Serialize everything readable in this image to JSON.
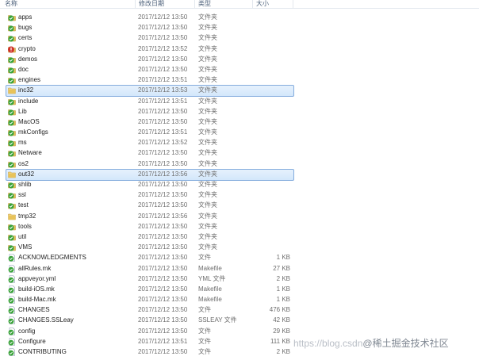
{
  "columns": {
    "name": "名称",
    "date": "修改日期",
    "type": "类型",
    "size": "大小"
  },
  "rows": [
    {
      "name": "apps",
      "date": "2017/12/12 13:50",
      "type": "文件夹",
      "size": "",
      "icon": "tortoise-folder-icon",
      "selected": false
    },
    {
      "name": "bugs",
      "date": "2017/12/12 13:50",
      "type": "文件夹",
      "size": "",
      "icon": "tortoise-folder-icon",
      "selected": false
    },
    {
      "name": "certs",
      "date": "2017/12/12 13:50",
      "type": "文件夹",
      "size": "",
      "icon": "tortoise-folder-icon",
      "selected": false
    },
    {
      "name": "crypto",
      "date": "2017/12/12 13:52",
      "type": "文件夹",
      "size": "",
      "icon": "tortoise-modified-folder-icon",
      "selected": false
    },
    {
      "name": "demos",
      "date": "2017/12/12 13:50",
      "type": "文件夹",
      "size": "",
      "icon": "tortoise-folder-icon",
      "selected": false
    },
    {
      "name": "doc",
      "date": "2017/12/12 13:50",
      "type": "文件夹",
      "size": "",
      "icon": "tortoise-folder-icon",
      "selected": false
    },
    {
      "name": "engines",
      "date": "2017/12/12 13:51",
      "type": "文件夹",
      "size": "",
      "icon": "tortoise-folder-icon",
      "selected": false
    },
    {
      "name": "inc32",
      "date": "2017/12/12 13:53",
      "type": "文件夹",
      "size": "",
      "icon": "folder-icon",
      "selected": true
    },
    {
      "name": "include",
      "date": "2017/12/12 13:51",
      "type": "文件夹",
      "size": "",
      "icon": "tortoise-folder-icon",
      "selected": false
    },
    {
      "name": "Lib",
      "date": "2017/12/12 13:50",
      "type": "文件夹",
      "size": "",
      "icon": "tortoise-folder-icon",
      "selected": false
    },
    {
      "name": "MacOS",
      "date": "2017/12/12 13:50",
      "type": "文件夹",
      "size": "",
      "icon": "tortoise-folder-icon",
      "selected": false
    },
    {
      "name": "mkConfigs",
      "date": "2017/12/12 13:51",
      "type": "文件夹",
      "size": "",
      "icon": "tortoise-folder-icon",
      "selected": false
    },
    {
      "name": "ms",
      "date": "2017/12/12 13:52",
      "type": "文件夹",
      "size": "",
      "icon": "tortoise-folder-icon",
      "selected": false
    },
    {
      "name": "Netware",
      "date": "2017/12/12 13:50",
      "type": "文件夹",
      "size": "",
      "icon": "tortoise-folder-icon",
      "selected": false
    },
    {
      "name": "os2",
      "date": "2017/12/12 13:50",
      "type": "文件夹",
      "size": "",
      "icon": "tortoise-folder-icon",
      "selected": false
    },
    {
      "name": "out32",
      "date": "2017/12/12 13:56",
      "type": "文件夹",
      "size": "",
      "icon": "folder-icon",
      "selected": true
    },
    {
      "name": "shlib",
      "date": "2017/12/12 13:50",
      "type": "文件夹",
      "size": "",
      "icon": "tortoise-folder-icon",
      "selected": false
    },
    {
      "name": "ssl",
      "date": "2017/12/12 13:50",
      "type": "文件夹",
      "size": "",
      "icon": "tortoise-folder-icon",
      "selected": false
    },
    {
      "name": "test",
      "date": "2017/12/12 13:50",
      "type": "文件夹",
      "size": "",
      "icon": "tortoise-folder-icon",
      "selected": false
    },
    {
      "name": "tmp32",
      "date": "2017/12/12 13:56",
      "type": "文件夹",
      "size": "",
      "icon": "folder-icon",
      "selected": false
    },
    {
      "name": "tools",
      "date": "2017/12/12 13:50",
      "type": "文件夹",
      "size": "",
      "icon": "tortoise-folder-icon",
      "selected": false
    },
    {
      "name": "util",
      "date": "2017/12/12 13:50",
      "type": "文件夹",
      "size": "",
      "icon": "tortoise-folder-icon",
      "selected": false
    },
    {
      "name": "VMS",
      "date": "2017/12/12 13:50",
      "type": "文件夹",
      "size": "",
      "icon": "tortoise-folder-icon",
      "selected": false
    },
    {
      "name": "ACKNOWLEDGMENTS",
      "date": "2017/12/12 13:50",
      "type": "文件",
      "size": "1 KB",
      "icon": "tortoise-file-icon",
      "selected": false
    },
    {
      "name": "allRules.mk",
      "date": "2017/12/12 13:50",
      "type": "Makefile",
      "size": "27 KB",
      "icon": "tortoise-file-icon",
      "selected": false
    },
    {
      "name": "appveyor.yml",
      "date": "2017/12/12 13:50",
      "type": "YML 文件",
      "size": "2 KB",
      "icon": "tortoise-file-icon",
      "selected": false
    },
    {
      "name": "build-iOS.mk",
      "date": "2017/12/12 13:50",
      "type": "Makefile",
      "size": "1 KB",
      "icon": "tortoise-file-icon",
      "selected": false
    },
    {
      "name": "build-Mac.mk",
      "date": "2017/12/12 13:50",
      "type": "Makefile",
      "size": "1 KB",
      "icon": "tortoise-file-icon",
      "selected": false
    },
    {
      "name": "CHANGES",
      "date": "2017/12/12 13:50",
      "type": "文件",
      "size": "476 KB",
      "icon": "tortoise-file-icon",
      "selected": false
    },
    {
      "name": "CHANGES.SSLeay",
      "date": "2017/12/12 13:50",
      "type": "SSLEAY 文件",
      "size": "42 KB",
      "icon": "tortoise-file-icon",
      "selected": false
    },
    {
      "name": "config",
      "date": "2017/12/12 13:50",
      "type": "文件",
      "size": "29 KB",
      "icon": "tortoise-file-icon",
      "selected": false
    },
    {
      "name": "Configure",
      "date": "2017/12/12 13:51",
      "type": "文件",
      "size": "111 KB",
      "icon": "tortoise-file-icon",
      "selected": false
    },
    {
      "name": "CONTRIBUTING",
      "date": "2017/12/12 13:50",
      "type": "文件",
      "size": "2 KB",
      "icon": "tortoise-file-icon",
      "selected": false
    }
  ],
  "watermark": {
    "url_text": "https://blog.csdn",
    "brand_text": "@稀土掘金技术社区"
  },
  "colors": {
    "selection_fill": "#d9eafb",
    "selection_border": "#84acdd",
    "tortoise_green": "#3aa33a",
    "tortoise_modified_red": "#d0332b",
    "folder_yellow": "#e8c35a"
  }
}
